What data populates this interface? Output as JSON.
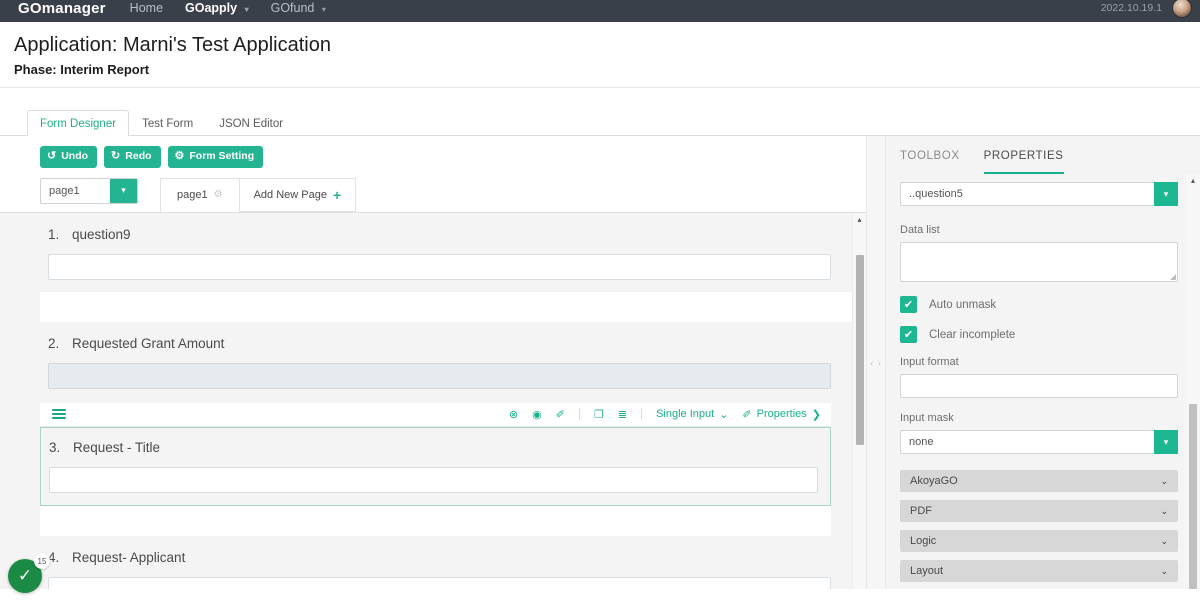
{
  "topnav": {
    "brand": "GOmanager",
    "links": [
      {
        "label": "Home",
        "caret": "",
        "active": false
      },
      {
        "label": "GOapply",
        "caret": "▾",
        "active": true
      },
      {
        "label": "GOfund",
        "caret": "▾",
        "active": false
      }
    ],
    "version": "2022.10.19.1",
    "avatar_name": "user-avatar"
  },
  "header": {
    "title": "Application: Marni's Test Application",
    "phase": "Phase: Interim Report"
  },
  "tabs": [
    {
      "label": "Form Designer",
      "active": true
    },
    {
      "label": "Test Form",
      "active": false
    },
    {
      "label": "JSON Editor",
      "active": false
    }
  ],
  "toolbar": {
    "undo": {
      "label": "Undo",
      "icon": "↺"
    },
    "redo": {
      "label": "Redo",
      "icon": "↻"
    },
    "form_setting": {
      "label": "Form Setting",
      "icon": "⚙"
    }
  },
  "pages": {
    "select_value": "page1",
    "select_caret": "▾",
    "active_tab": "page1",
    "tab_gear": "⚙",
    "add_new_page": "Add New Page",
    "add_plus": "+"
  },
  "canvas": {
    "questions": [
      {
        "num": "1.",
        "label": "question9",
        "input_state": "normal"
      },
      {
        "num": "2.",
        "label": "Requested Grant Amount",
        "input_state": "disabled"
      },
      {
        "num": "3.",
        "label": "Request - Title",
        "input_state": "normal",
        "selected": true
      },
      {
        "num": "4.",
        "label": "Request- Applicant",
        "input_state": "normal"
      }
    ],
    "selected_toolbar": {
      "drag_handle": "drag-handle-icon",
      "icons": [
        {
          "name": "delete-icon",
          "glyph": "⊗"
        },
        {
          "name": "eye-icon",
          "glyph": "◉"
        },
        {
          "name": "edit-pen-icon",
          "glyph": "✐"
        },
        {
          "name": "duplicate-icon",
          "glyph": "❐"
        },
        {
          "name": "list-settings-icon",
          "glyph": "≣"
        }
      ],
      "type_label": "Single Input",
      "type_caret": "⌄",
      "properties_label": "Properties",
      "properties_caret": "❯",
      "properties_icon": "✐"
    },
    "scroll_up_arrow": "▴"
  },
  "splitter": {
    "grip": "‹ ›"
  },
  "properties": {
    "tabs": [
      {
        "label": "TOOLBOX",
        "active": false
      },
      {
        "label": "PROPERTIES",
        "active": true
      }
    ],
    "element_select": {
      "value": "..question5",
      "caret": "▾"
    },
    "data_list": {
      "label": "Data list",
      "value": ""
    },
    "checkboxes": [
      {
        "label": "Auto unmask",
        "checked": true,
        "glyph": "✔"
      },
      {
        "label": "Clear incomplete",
        "checked": true,
        "glyph": "✔"
      }
    ],
    "input_format": {
      "label": "Input format",
      "value": ""
    },
    "input_mask": {
      "label": "Input mask",
      "value": "none",
      "caret": "▾"
    },
    "accordions": [
      {
        "label": "AkoyaGO",
        "chev": "⌄"
      },
      {
        "label": "PDF",
        "chev": "⌄"
      },
      {
        "label": "Logic",
        "chev": "⌄"
      },
      {
        "label": "Layout",
        "chev": "⌄"
      }
    ],
    "scroll_up_arrow": "▴"
  },
  "status_badge": {
    "glyph": "✓",
    "count": "15"
  },
  "colors": {
    "accent_green": "#25b491",
    "nav_dark": "#3a4049",
    "tab_active": "#22b087",
    "badge_green": "#1a8a45"
  }
}
